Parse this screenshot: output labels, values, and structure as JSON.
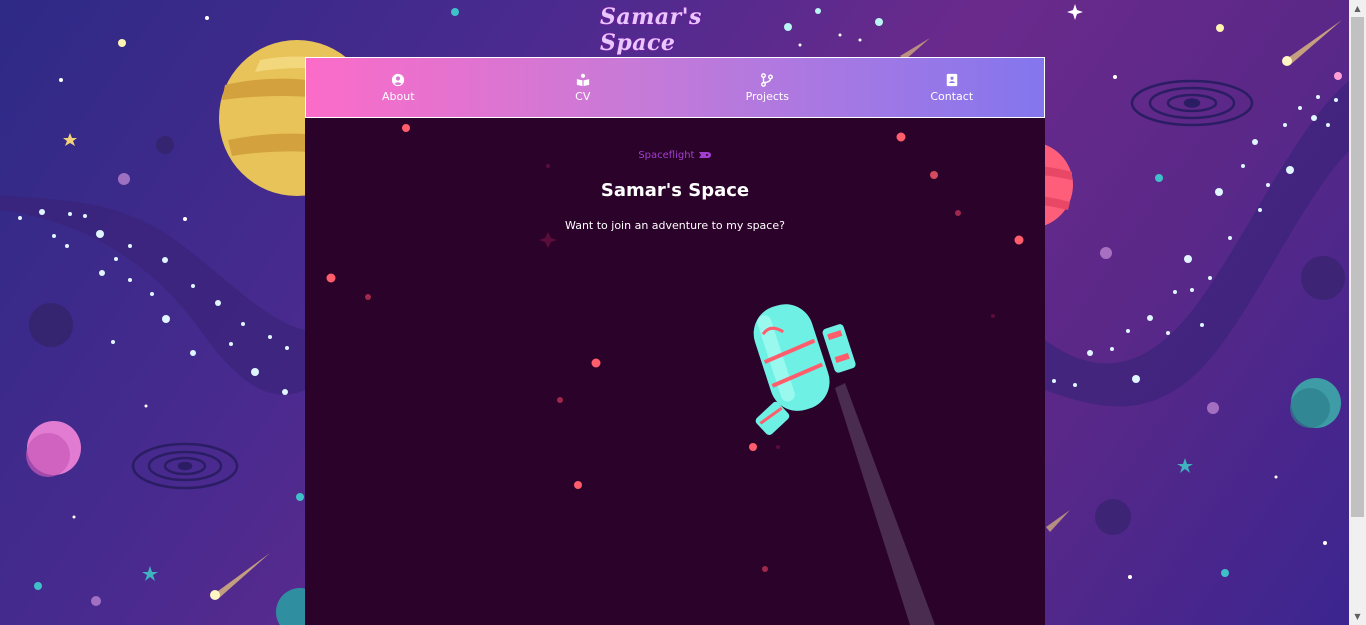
{
  "site": {
    "logo_text": "Samar's Space"
  },
  "nav": {
    "items": [
      {
        "label": "About",
        "icon": "user-circle-icon"
      },
      {
        "label": "CV",
        "icon": "book-reader-icon"
      },
      {
        "label": "Projects",
        "icon": "code-branch-icon"
      },
      {
        "label": "Contact",
        "icon": "address-card-icon"
      }
    ],
    "gradient": [
      "#fb6cc8",
      "#c77ad8",
      "#8476ee"
    ]
  },
  "hero": {
    "kicker": "Spaceflight",
    "kicker_icon": "rocket-icon",
    "title": "Samar's Space",
    "tagline": "Want to join an adventure to my space?"
  },
  "colors": {
    "panel_bg": "#2b0229",
    "kicker": "#a13fd0",
    "astronaut": "#6ff0e4",
    "accent_red": "#ff5d6c"
  }
}
